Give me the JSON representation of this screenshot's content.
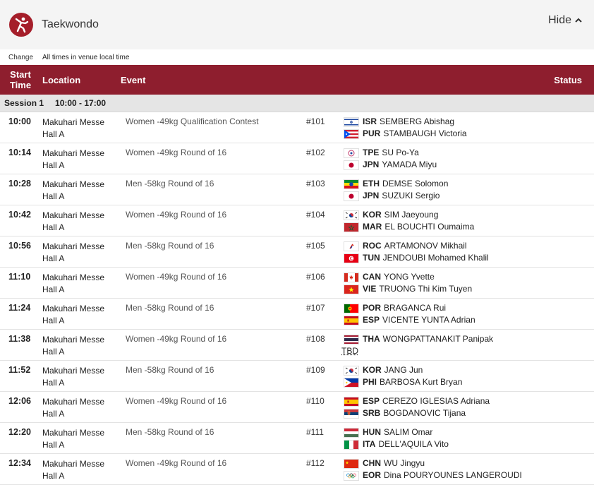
{
  "header": {
    "title": "Taekwondo",
    "hide_label": "Hide"
  },
  "subbar": {
    "change": "Change",
    "note": "All times in venue local time"
  },
  "table_headers": {
    "start_time_1": "Start",
    "start_time_2": "Time",
    "location": "Location",
    "event": "Event",
    "status": "Status"
  },
  "session": {
    "label": "Session 1",
    "time": "10:00 - 17:00"
  },
  "rows": [
    {
      "time": "10:00",
      "loc1": "Makuhari Messe",
      "loc2": "Hall A",
      "event": "Women -49kg Qualification Contest",
      "match": "#101",
      "c1": {
        "flag": "ISR",
        "code": "ISR",
        "name": "SEMBERG Abishag"
      },
      "c2": {
        "flag": "PUR",
        "code": "PUR",
        "name": "STAMBAUGH Victoria"
      }
    },
    {
      "time": "10:14",
      "loc1": "Makuhari Messe",
      "loc2": "Hall A",
      "event": "Women -49kg Round of 16",
      "match": "#102",
      "c1": {
        "flag": "TPE",
        "code": "TPE",
        "name": "SU Po-Ya"
      },
      "c2": {
        "flag": "JPN",
        "code": "JPN",
        "name": "YAMADA Miyu"
      }
    },
    {
      "time": "10:28",
      "loc1": "Makuhari Messe",
      "loc2": "Hall A",
      "event": "Men -58kg Round of 16",
      "match": "#103",
      "c1": {
        "flag": "ETH",
        "code": "ETH",
        "name": "DEMSE Solomon"
      },
      "c2": {
        "flag": "JPN",
        "code": "JPN",
        "name": "SUZUKI Sergio"
      }
    },
    {
      "time": "10:42",
      "loc1": "Makuhari Messe",
      "loc2": "Hall A",
      "event": "Women -49kg Round of 16",
      "match": "#104",
      "c1": {
        "flag": "KOR",
        "code": "KOR",
        "name": "SIM Jaeyoung"
      },
      "c2": {
        "flag": "MAR",
        "code": "MAR",
        "name": "EL BOUCHTI Oumaima"
      }
    },
    {
      "time": "10:56",
      "loc1": "Makuhari Messe",
      "loc2": "Hall A",
      "event": "Men -58kg Round of 16",
      "match": "#105",
      "c1": {
        "flag": "ROC",
        "code": "ROC",
        "name": "ARTAMONOV Mikhail"
      },
      "c2": {
        "flag": "TUN",
        "code": "TUN",
        "name": "JENDOUBI Mohamed Khalil"
      }
    },
    {
      "time": "11:10",
      "loc1": "Makuhari Messe",
      "loc2": "Hall A",
      "event": "Women -49kg Round of 16",
      "match": "#106",
      "c1": {
        "flag": "CAN",
        "code": "CAN",
        "name": "YONG Yvette"
      },
      "c2": {
        "flag": "VIE",
        "code": "VIE",
        "name": "TRUONG Thi Kim Tuyen"
      }
    },
    {
      "time": "11:24",
      "loc1": "Makuhari Messe",
      "loc2": "Hall A",
      "event": "Men -58kg Round of 16",
      "match": "#107",
      "c1": {
        "flag": "POR",
        "code": "POR",
        "name": "BRAGANCA Rui"
      },
      "c2": {
        "flag": "ESP",
        "code": "ESP",
        "name": "VICENTE YUNTA Adrian"
      }
    },
    {
      "time": "11:38",
      "loc1": "Makuhari Messe",
      "loc2": "Hall A",
      "event": "Women -49kg Round of 16",
      "match": "#108",
      "c1": {
        "flag": "THA",
        "code": "THA",
        "name": "WONGPATTANAKIT Panipak"
      },
      "c2": {
        "flag": "",
        "code": "",
        "name": "TBD"
      }
    },
    {
      "time": "11:52",
      "loc1": "Makuhari Messe",
      "loc2": "Hall A",
      "event": "Men -58kg Round of 16",
      "match": "#109",
      "c1": {
        "flag": "KOR",
        "code": "KOR",
        "name": "JANG Jun"
      },
      "c2": {
        "flag": "PHI",
        "code": "PHI",
        "name": "BARBOSA Kurt Bryan"
      }
    },
    {
      "time": "12:06",
      "loc1": "Makuhari Messe",
      "loc2": "Hall A",
      "event": "Women -49kg Round of 16",
      "match": "#110",
      "c1": {
        "flag": "ESP",
        "code": "ESP",
        "name": "CEREZO IGLESIAS Adriana"
      },
      "c2": {
        "flag": "SRB",
        "code": "SRB",
        "name": "BOGDANOVIC Tijana"
      }
    },
    {
      "time": "12:20",
      "loc1": "Makuhari Messe",
      "loc2": "Hall A",
      "event": "Men -58kg Round of 16",
      "match": "#111",
      "c1": {
        "flag": "HUN",
        "code": "HUN",
        "name": "SALIM Omar"
      },
      "c2": {
        "flag": "ITA",
        "code": "ITA",
        "name": "DELL'AQUILA Vito"
      }
    },
    {
      "time": "12:34",
      "loc1": "Makuhari Messe",
      "loc2": "Hall A",
      "event": "Women -49kg Round of 16",
      "match": "#112",
      "c1": {
        "flag": "CHN",
        "code": "CHN",
        "name": "WU Jingyu"
      },
      "c2": {
        "flag": "EOR",
        "code": "EOR",
        "name": "Dina POURYOUNES LANGEROUDI"
      }
    }
  ],
  "colors": {
    "brand": "#8e1e2e",
    "logo": "#a51e2a",
    "session_bg": "#e5e5e5",
    "header_bg": "#f4f4f4"
  },
  "icons": {
    "logo": "taekwondo-pictogram-icon",
    "hide": "chevron-up-icon"
  }
}
